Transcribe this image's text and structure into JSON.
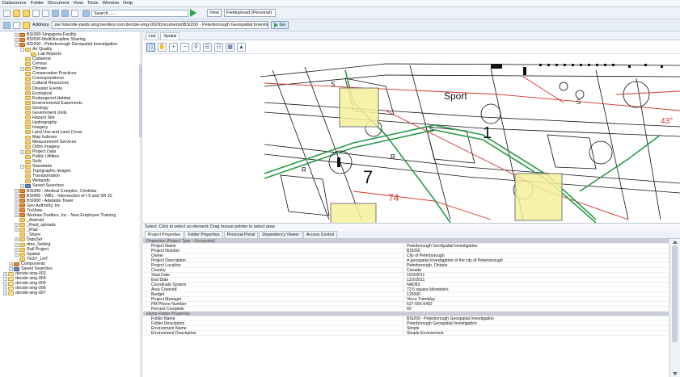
{
  "menu": [
    "Datasource",
    "Folder",
    "Document",
    "View",
    "Tools",
    "Window",
    "Help"
  ],
  "toolbar": {
    "search_value": "Search .....",
    "view_label": "View",
    "view_value": "Fieldupload (Personal)"
  },
  "address": {
    "label": "Address",
    "value": "pw:\\\\decide-pwds.sing.bentley.com:decide-sing-002\\Documents\\BSI200 - Peterborough Geospatial Investiga",
    "go_label": "Go"
  },
  "tree": [
    {
      "label": "BSI300-Singapore-Facility",
      "indent": 3,
      "expander": "+",
      "icon": "ws"
    },
    {
      "label": "BSI500-MultiDiscipline Sharing",
      "indent": 3,
      "expander": "+",
      "icon": "ws"
    },
    {
      "label": "BSI200 - Peterborough Geospatial Investigation",
      "indent": 3,
      "expander": "-",
      "icon": "ws"
    },
    {
      "label": "Air Quality",
      "indent": 4,
      "expander": "-",
      "icon": "folder"
    },
    {
      "label": "Lab Reports",
      "indent": 5,
      "expander": "",
      "icon": "folder"
    },
    {
      "label": "Cadastral",
      "indent": 4,
      "expander": "",
      "icon": "folder"
    },
    {
      "label": "Census",
      "indent": 4,
      "expander": "",
      "icon": "folder"
    },
    {
      "label": "Climate",
      "indent": 4,
      "expander": "+",
      "icon": "folder"
    },
    {
      "label": "Conservation Practices",
      "indent": 4,
      "expander": "",
      "icon": "folder"
    },
    {
      "label": "Correspondence",
      "indent": 4,
      "expander": "",
      "icon": "folder"
    },
    {
      "label": "Cultural Resources",
      "indent": 4,
      "expander": "",
      "icon": "folder"
    },
    {
      "label": "Disaster Events",
      "indent": 4,
      "expander": "",
      "icon": "folder"
    },
    {
      "label": "Ecological",
      "indent": 4,
      "expander": "",
      "icon": "folder"
    },
    {
      "label": "Endangered Habitat",
      "indent": 4,
      "expander": "",
      "icon": "folder"
    },
    {
      "label": "Environmental Easements",
      "indent": 4,
      "expander": "",
      "icon": "folder"
    },
    {
      "label": "Geology",
      "indent": 4,
      "expander": "",
      "icon": "folder"
    },
    {
      "label": "Government Units",
      "indent": 4,
      "expander": "",
      "icon": "folder"
    },
    {
      "label": "Hazard Site",
      "indent": 4,
      "expander": "",
      "icon": "folder"
    },
    {
      "label": "Hydrography",
      "indent": 4,
      "expander": "",
      "icon": "folder"
    },
    {
      "label": "Imagery",
      "indent": 4,
      "expander": "",
      "icon": "folder"
    },
    {
      "label": "Land Use and Land Cover",
      "indent": 4,
      "expander": "",
      "icon": "folder"
    },
    {
      "label": "Map Indexes",
      "indent": 4,
      "expander": "",
      "icon": "folder"
    },
    {
      "label": "Measurement Services",
      "indent": 4,
      "expander": "",
      "icon": "folder"
    },
    {
      "label": "Ortho Imagery",
      "indent": 4,
      "expander": "",
      "icon": "folder"
    },
    {
      "label": "Project Data",
      "indent": 4,
      "expander": "+",
      "icon": "folder"
    },
    {
      "label": "Public Utilities",
      "indent": 4,
      "expander": "",
      "icon": "folder"
    },
    {
      "label": "Soils",
      "indent": 4,
      "expander": "",
      "icon": "folder"
    },
    {
      "label": "Standards",
      "indent": 4,
      "expander": "+",
      "icon": "folder"
    },
    {
      "label": "Topographic Images",
      "indent": 4,
      "expander": "",
      "icon": "folder"
    },
    {
      "label": "Transportation",
      "indent": 4,
      "expander": "",
      "icon": "folder"
    },
    {
      "label": "Wetlands",
      "indent": 4,
      "expander": "",
      "icon": "folder"
    },
    {
      "label": "Saved Searches",
      "indent": 4,
      "expander": "+",
      "icon": "search"
    },
    {
      "label": "BSI300 - Medical Complex- Córdoba",
      "indent": 3,
      "expander": "+",
      "icon": "ws"
    },
    {
      "label": "BSI400 - WB1 - Intersection of I-9 and SR 32",
      "indent": 3,
      "expander": "+",
      "icon": "ws"
    },
    {
      "label": "BSI900 - Adelaide Tower",
      "indent": 3,
      "expander": "+",
      "icon": "ws"
    },
    {
      "label": "Geo Authority, Inc",
      "indent": 3,
      "expander": "+",
      "icon": "ws"
    },
    {
      "label": "TruView",
      "indent": 3,
      "expander": "+",
      "icon": "ws"
    },
    {
      "label": "Wedraw Drafters, Inc - New Employee Training",
      "indent": 3,
      "expander": "+",
      "icon": "ws"
    },
    {
      "label": "_Android",
      "indent": 3,
      "expander": "",
      "icon": "folder"
    },
    {
      "label": "_Field_uploads",
      "indent": 3,
      "expander": "+",
      "icon": "folder"
    },
    {
      "label": "_iPad",
      "indent": 3,
      "expander": "+",
      "icon": "folder"
    },
    {
      "label": "_Share",
      "indent": 3,
      "expander": "",
      "icon": "folder"
    },
    {
      "label": "DataSet",
      "indent": 3,
      "expander": "+",
      "icon": "folder"
    },
    {
      "label": "dms_Setting",
      "indent": 3,
      "expander": "+",
      "icon": "folder"
    },
    {
      "label": "Rail Project",
      "indent": 3,
      "expander": "+",
      "icon": "folder"
    },
    {
      "label": "Spatial",
      "indent": 3,
      "expander": "+",
      "icon": "folder"
    },
    {
      "label": "TEST_LHT",
      "indent": 3,
      "expander": "",
      "icon": "folder"
    },
    {
      "label": "Components",
      "indent": 2,
      "expander": "+",
      "icon": "ws"
    },
    {
      "label": "Saved Searches",
      "indent": 2,
      "expander": "+",
      "icon": "search"
    },
    {
      "label": "decide-sing-003",
      "indent": 1,
      "expander": "+",
      "icon": "db"
    },
    {
      "label": "decide-sing-004",
      "indent": 1,
      "expander": "+",
      "icon": "db"
    },
    {
      "label": "decide-sing-005",
      "indent": 1,
      "expander": "+",
      "icon": "db"
    },
    {
      "label": "decide-sing-006",
      "indent": 1,
      "expander": "+",
      "icon": "db"
    },
    {
      "label": "decide-sing-007",
      "indent": 1,
      "expander": "+",
      "icon": "db"
    }
  ],
  "view_tabs": [
    "List",
    "Spatial"
  ],
  "map": {
    "labels": [
      "Sport",
      "43°",
      "74",
      "7",
      "1",
      "R",
      "R",
      "S",
      "S",
      "S"
    ]
  },
  "status_text": "Select: Click to select an element; Drag mouse pointer to select area",
  "prop_tabs": [
    "Project Properties",
    "Folder Properties",
    "Personal Portal",
    "Dependency Viewer",
    "Access Control"
  ],
  "properties": [
    {
      "group": "Properties (Project Type - Geospatial)"
    },
    {
      "k": "Project Name",
      "v": "Peterborough GeoSpatial Investigation"
    },
    {
      "k": "Project Number",
      "v": "BSI200"
    },
    {
      "k": "Owner",
      "v": "City of Peterborough"
    },
    {
      "k": "Project Description",
      "v": "A geospatial investigation of the city of Peterborough"
    },
    {
      "k": "Project Location",
      "v": "Peterborough, Ontario"
    },
    {
      "k": "Country",
      "v": "Canada"
    },
    {
      "k": "Start Date",
      "v": "10/3/2011"
    },
    {
      "k": "End Date",
      "v": "12/2/2011"
    },
    {
      "k": "Coordinate System",
      "v": "NAD83"
    },
    {
      "k": "Area Covered",
      "v": "73.5 square kilometers"
    },
    {
      "k": "Budget",
      "v": "125000"
    },
    {
      "k": "Project Manager",
      "v": "Vince Tremblay"
    },
    {
      "k": "PM Phone Number",
      "v": "527-555-5492"
    },
    {
      "k": "Percent Complete",
      "v": "60"
    },
    {
      "group": "Home Folder Properties"
    },
    {
      "k": "Folder Name",
      "v": "BSI200 - Peterborough Geospatial Investigation"
    },
    {
      "k": "Folder Description",
      "v": "Peterborough Geospatial Investigation"
    },
    {
      "k": "Environment Name",
      "v": "Simple"
    },
    {
      "k": "Environment Description",
      "v": "Simple Environment"
    }
  ]
}
